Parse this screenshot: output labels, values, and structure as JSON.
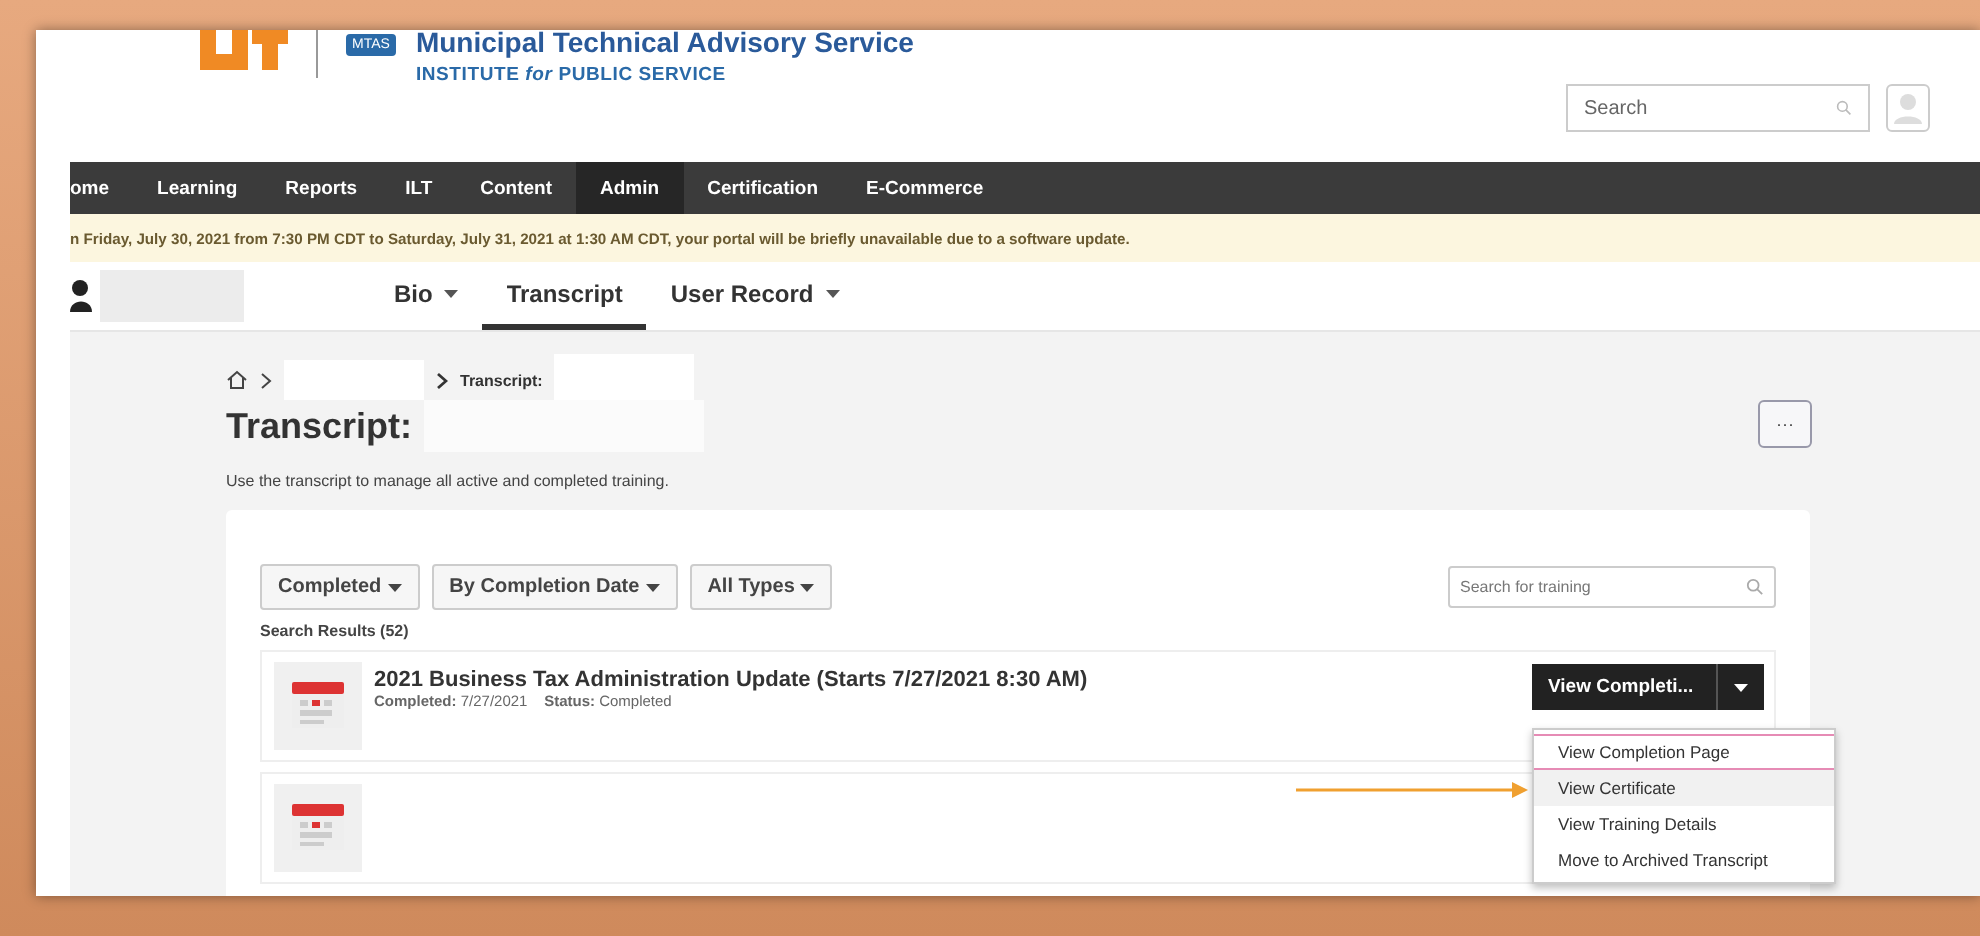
{
  "header": {
    "org_name": "Municipal Technical Advisory Service",
    "org_subtitle": "INSTITUTE *for* PUBLIC SERVICE",
    "badge": "MTAS",
    "search": {
      "placeholder": "Search"
    }
  },
  "nav": [
    {
      "label": "ome",
      "selected": false
    },
    {
      "label": "Learning",
      "selected": false
    },
    {
      "label": "Reports",
      "selected": false
    },
    {
      "label": "ILT",
      "selected": false
    },
    {
      "label": "Content",
      "selected": false
    },
    {
      "label": "Admin",
      "selected": true
    },
    {
      "label": "Certification",
      "selected": false
    },
    {
      "label": "E-Commerce",
      "selected": false
    }
  ],
  "banner": "n Friday, July 30, 2021 from 7:30 PM CDT to Saturday, July 31, 2021 at 1:30 AM CDT, your portal will be briefly unavailable due to a software update.",
  "profile_tabs": [
    {
      "label": "Bio",
      "has_menu": true,
      "selected": false
    },
    {
      "label": "Transcript",
      "has_menu": false,
      "selected": true
    },
    {
      "label": "User Record",
      "has_menu": true,
      "selected": false
    }
  ],
  "breadcrumb": {
    "current": "Transcript:"
  },
  "page": {
    "title": "Transcript:",
    "description": "Use the transcript to manage all active and completed training.",
    "more_button": "···"
  },
  "filters": [
    {
      "label": "Completed"
    },
    {
      "label": "By Completion Date"
    },
    {
      "label": "All Types"
    }
  ],
  "training_search": {
    "placeholder": "Search for training"
  },
  "results_label": "Search Results (52)",
  "results": [
    {
      "title": "2021 Business Tax Administration Update (Starts 7/27/2021 8:30 AM)",
      "completed_label": "Completed:",
      "completed": "7/27/2021",
      "status_label": "Status:",
      "status": "Completed",
      "action": "View Completi...",
      "kind": "course"
    },
    {
      "kind": "course"
    }
  ],
  "action_menu": [
    {
      "label": "View Completion Page",
      "selected": true,
      "hovered": false
    },
    {
      "label": "View Certificate",
      "selected": false,
      "hovered": true
    },
    {
      "label": "View Training Details",
      "selected": false,
      "hovered": false
    },
    {
      "label": "Move to Archived Transcript",
      "selected": false,
      "hovered": false
    }
  ]
}
